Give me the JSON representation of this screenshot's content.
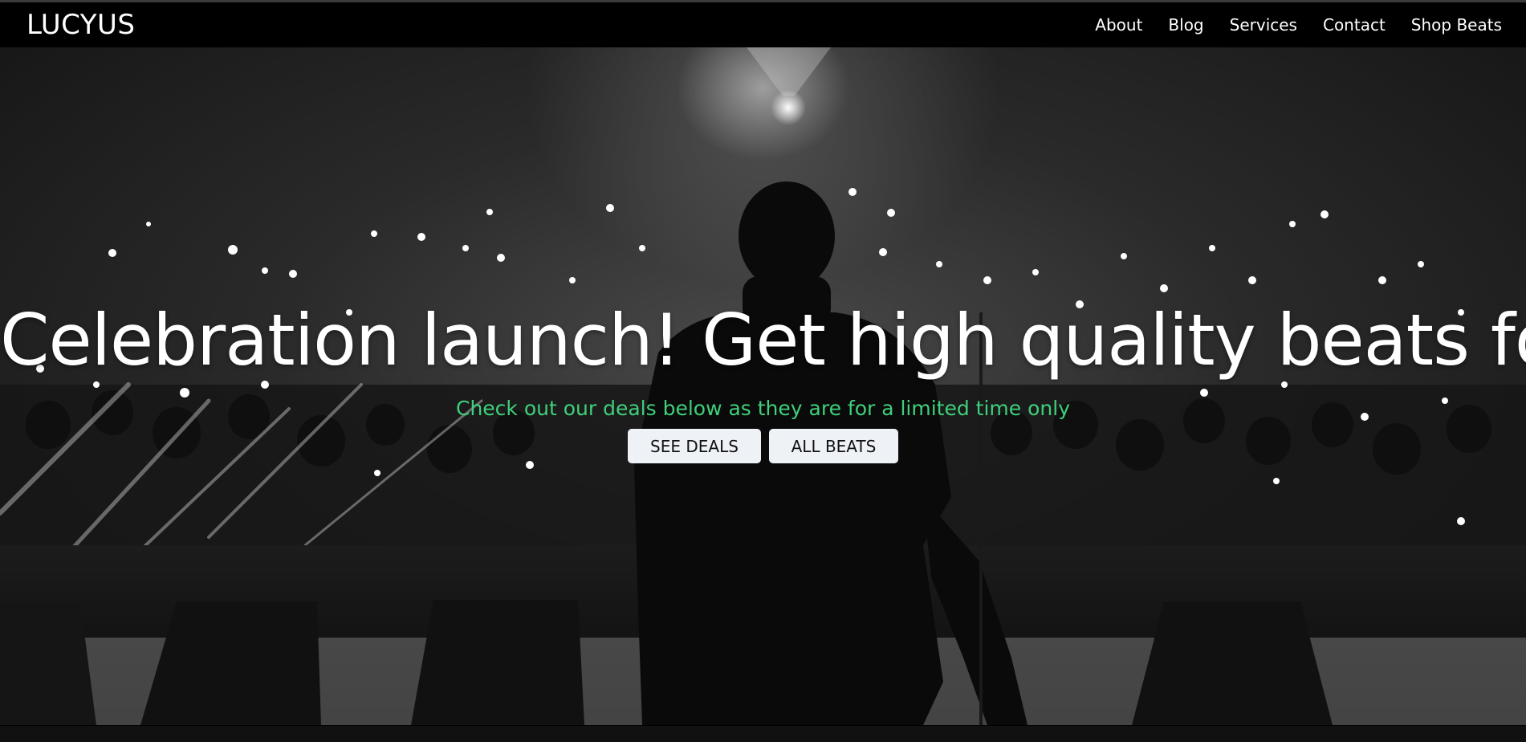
{
  "header": {
    "logo": "LUCYUS",
    "nav": [
      "About",
      "Blog",
      "Services",
      "Contact",
      "Shop Beats"
    ]
  },
  "hero": {
    "headline": "Celebration launch! Get high quality beats for sale.",
    "subline": "Check out our deals below as they are for a limited time only",
    "buttons": {
      "see_deals": "SEE DEALS",
      "all_beats": "ALL BEATS"
    }
  },
  "colors": {
    "accent_green": "#3ed07a",
    "button_bg": "#eef2f7",
    "header_bg": "#000000"
  }
}
